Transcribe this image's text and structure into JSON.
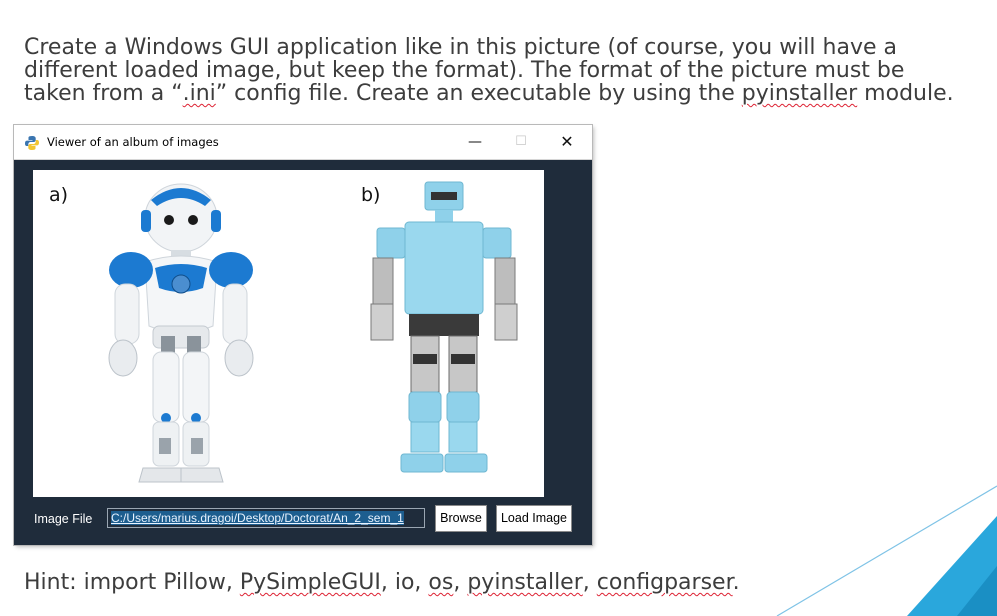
{
  "slide": {
    "task_lines": [
      [
        "Create a Windows GUI application like in this picture (of course, you will have a"
      ],
      [
        "different loaded image, but keep the format). The format of the picture must be"
      ],
      [
        "taken from a “",
        ".ini",
        "” config file. Create an executable by using the ",
        "pyinstaller",
        " module."
      ]
    ],
    "hint_parts": [
      "Hint: import Pillow, ",
      "PySimpleGUI",
      ", io, ",
      "os",
      ", ",
      "pyinstaller",
      ", ",
      "configparser",
      "."
    ]
  },
  "window": {
    "title": "Viewer of an album of images",
    "controls": {
      "minimize": "—",
      "maximize": "☐",
      "close": "✕"
    },
    "background_color": "#1f2c3b",
    "image_labels": {
      "a": "a)",
      "b": "b)"
    },
    "robots": {
      "a": {
        "accent": "#1c7ad1"
      },
      "b": {
        "accent": "#8fd1ea"
      }
    },
    "image_file_label": "Image File",
    "image_file_value": "C:/Users/marius.dragoi/Desktop/Doctorat/An_2_sem_1",
    "browse_label": "Browse",
    "load_label": "Load Image"
  }
}
